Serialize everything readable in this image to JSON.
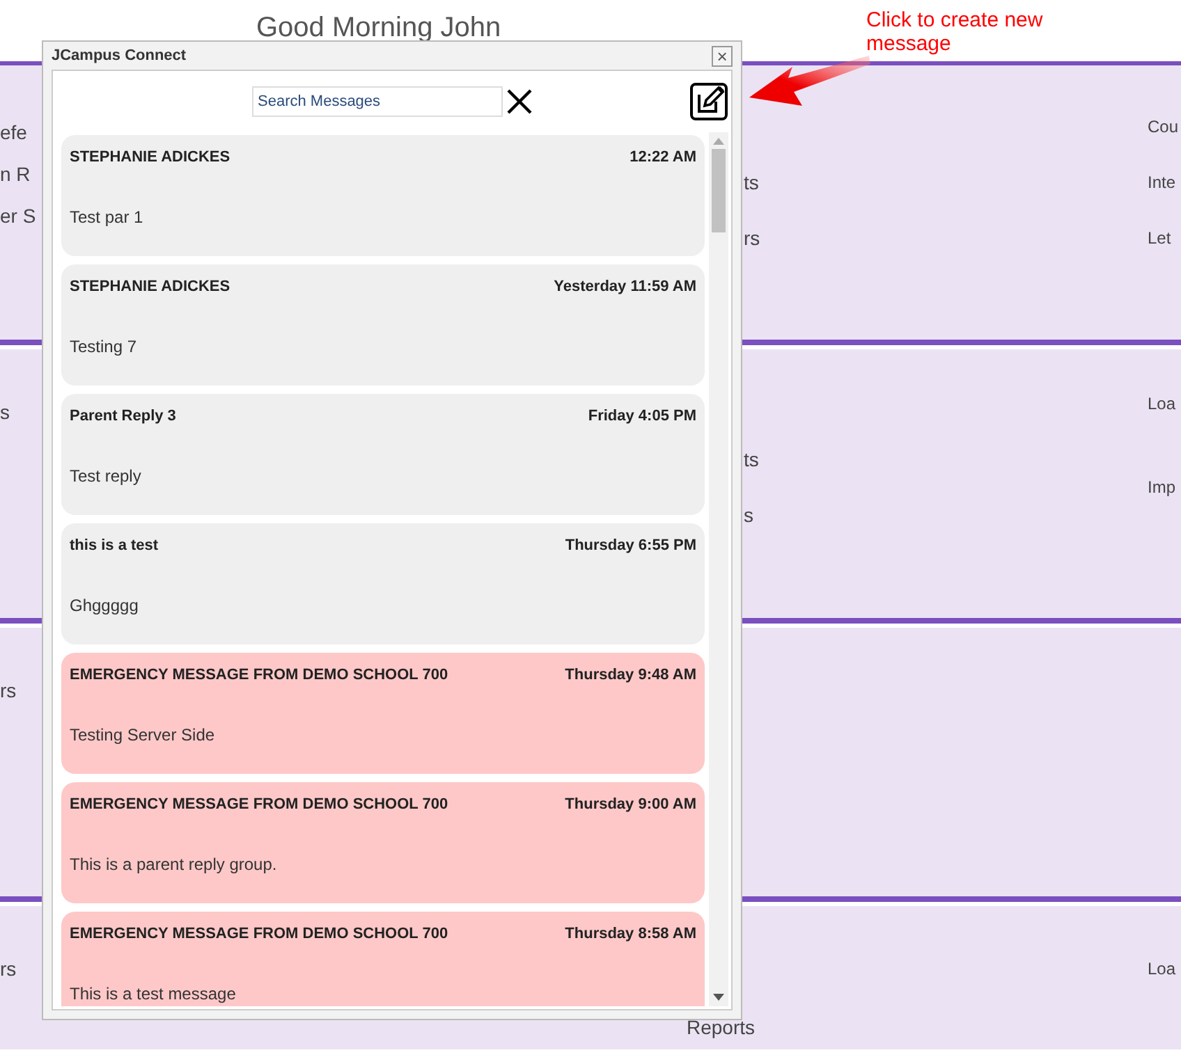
{
  "page": {
    "greeting": "Good Morning John"
  },
  "background_rows": [
    {
      "columns": [
        [
          "efe",
          "n R",
          "er S"
        ],
        [
          "ts",
          "rs"
        ],
        [
          "Cou",
          "Inte",
          "Let"
        ]
      ]
    },
    {
      "columns": [
        [
          "s"
        ],
        [
          "ts",
          "s"
        ],
        [
          "Loa",
          "Imp"
        ]
      ]
    },
    {
      "columns": [
        [
          "rs"
        ],
        [],
        []
      ]
    },
    {
      "columns": [
        [
          "rs"
        ],
        [
          "Reports"
        ],
        [
          "Loa"
        ]
      ]
    }
  ],
  "dialog": {
    "title": "JCampus Connect",
    "close": "×",
    "search": {
      "placeholder": "Search Messages"
    },
    "messages": [
      {
        "kind": "normal",
        "sender": "STEPHANIE ADICKES",
        "time": "12:22 AM",
        "body": "Test par 1"
      },
      {
        "kind": "normal",
        "sender": "STEPHANIE ADICKES",
        "time": "Yesterday 11:59 AM",
        "body": "Testing 7"
      },
      {
        "kind": "normal",
        "sender": "Parent Reply 3",
        "time": "Friday 4:05 PM",
        "body": "Test reply"
      },
      {
        "kind": "normal",
        "sender": "this is a test",
        "time": "Thursday 6:55 PM",
        "body": "Ghggggg"
      },
      {
        "kind": "emergency",
        "sender": "EMERGENCY MESSAGE FROM DEMO SCHOOL 700",
        "time": "Thursday 9:48 AM",
        "body": "Testing Server Side"
      },
      {
        "kind": "emergency",
        "sender": "EMERGENCY MESSAGE FROM DEMO SCHOOL 700",
        "time": "Thursday 9:00 AM",
        "body": "This is a parent reply group."
      },
      {
        "kind": "emergency",
        "sender": "EMERGENCY MESSAGE FROM DEMO SCHOOL 700",
        "time": "Thursday 8:58 AM",
        "body": "This is a test message"
      }
    ]
  },
  "annotation": {
    "text": "Click to create new message"
  }
}
